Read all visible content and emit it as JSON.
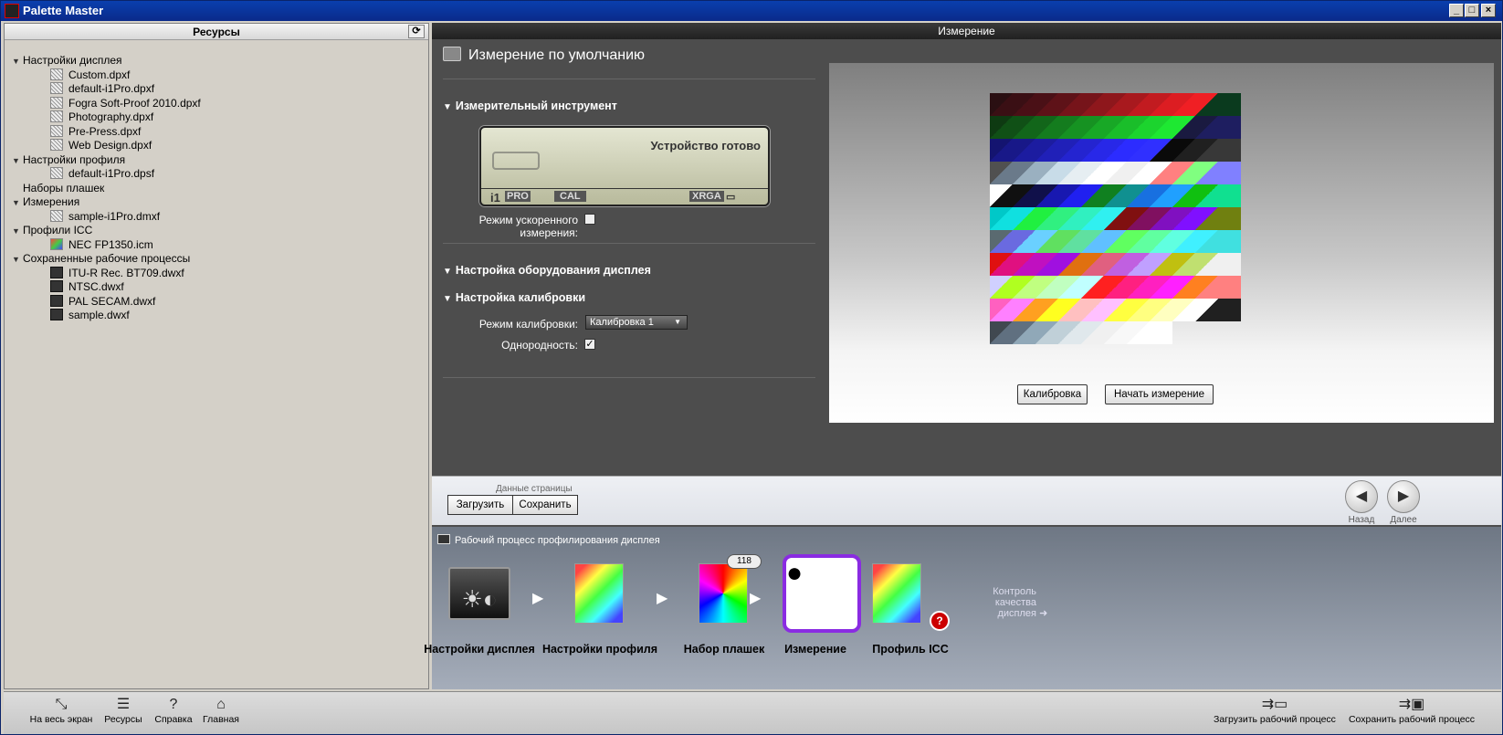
{
  "window": {
    "title": "Palette Master"
  },
  "left_panel": {
    "title": "Ресурсы",
    "tree": [
      {
        "label": "Настройки дисплея",
        "children": [
          "Custom.dpxf",
          "default-i1Pro.dpxf",
          "Fogra Soft-Proof 2010.dpxf",
          "Photography.dpxf",
          "Pre-Press.dpxf",
          "Web Design.dpxf"
        ]
      },
      {
        "label": "Настройки профиля",
        "children": [
          "default-i1Pro.dpsf"
        ]
      },
      {
        "label": "Наборы плашек",
        "children": []
      },
      {
        "label": "Измерения",
        "children": [
          "sample-i1Pro.dmxf"
        ]
      },
      {
        "label": "Профили ICC",
        "children": [
          "NEC FP1350.icm"
        ]
      },
      {
        "label": "Сохраненные рабочие процессы",
        "children": [
          "ITU-R Rec. BT709.dwxf",
          "NTSC.dwxf",
          "PAL SECAM.dwxf",
          "sample.dwxf"
        ]
      }
    ]
  },
  "main": {
    "header": "Измерение",
    "section_title": "Измерение по умолчанию",
    "instrument_group": "Измерительный инструмент",
    "lcd": {
      "status": "Устройство готово",
      "brand": "i1",
      "model": "PRO",
      "cal": "CAL",
      "mode": "XRGA"
    },
    "fast_mode_label": "Режим ускоренного измерения:",
    "fast_mode_checked": false,
    "hardware_group": "Настройка оборудования дисплея",
    "calibration_group": "Настройка калибровки",
    "calibration_mode_label": "Режим калибровки:",
    "calibration_mode_value": "Калибровка 1",
    "uniformity_label": "Однородность:",
    "uniformity_checked": true,
    "preview_buttons": {
      "calibrate": "Калибровка",
      "start": "Начать измерение"
    }
  },
  "page_bar": {
    "caption": "Данные страницы",
    "load": "Загрузить",
    "save": "Сохранить",
    "back": "Назад",
    "next": "Далее"
  },
  "workflow": {
    "title": "Рабочий процесс профилирования дисплея",
    "steps": [
      "Настройки дисплея",
      "Настройки профиля",
      "Набор плашек",
      "Измерение",
      "Профиль ICC"
    ],
    "patch_count": "118",
    "quality_control": "Контроль качества дисплея"
  },
  "bottom_bar": {
    "fullscreen": "На весь экран",
    "resources": "Ресурсы",
    "help": "Справка",
    "home": "Главная",
    "load_workflow": "Загрузить рабочий процесс",
    "save_workflow": "Сохранить рабочий процесс"
  },
  "patches": [
    [
      "#2a0f12",
      "#3a0f14",
      "#4a1016",
      "#5e1218",
      "#76141a",
      "#8e171c",
      "#a8191e",
      "#c21b20",
      "#dc1d22",
      "#f01f24",
      "#0a3a1e"
    ],
    [
      "#0e3a12",
      "#105016",
      "#12661a",
      "#147c1e",
      "#169222",
      "#18a826",
      "#1abe2a",
      "#1cd42e",
      "#1ee832",
      "#1a1a40",
      "#1e1e60"
    ],
    [
      "#141470",
      "#181888",
      "#1c1ca0",
      "#2020b8",
      "#2424d0",
      "#2828e8",
      "#2c2cff",
      "#3030ff",
      "#0a0a0a",
      "#202020",
      "#383838"
    ],
    [
      "#505050",
      "#6a7a8a",
      "#9ab0c0",
      "#c8dce8",
      "#e6eef2",
      "#ffffff",
      "#f0f0f0",
      "#ffffff",
      "#ff8080",
      "#80ff80",
      "#8080ff"
    ],
    [
      "#ffffff",
      "#101010",
      "#10104a",
      "#1818b0",
      "#2020f0",
      "#108020",
      "#109090",
      "#1870e0",
      "#20a0ff",
      "#10c010",
      "#10e090"
    ],
    [
      "#00c8c8",
      "#10e0e0",
      "#20f040",
      "#30f080",
      "#30f0c0",
      "#30f0f0",
      "#801010",
      "#801060",
      "#8010c0",
      "#8010ff",
      "#708010"
    ],
    [
      "#5a6a70",
      "#6a6ae0",
      "#6ad0ff",
      "#60e060",
      "#60e0a0",
      "#60c0ff",
      "#60ff60",
      "#60ffa0",
      "#60ffe0",
      "#40f0ff",
      "#40e0e0"
    ],
    [
      "#e01010",
      "#e01080",
      "#c010c0",
      "#a010e0",
      "#e07010",
      "#e06080",
      "#c060e0",
      "#c0a0ff",
      "#c0c010",
      "#c0e070",
      "#f0f0f0"
    ],
    [
      "#d0d0ff",
      "#b0ff20",
      "#c0ff80",
      "#c0ffc0",
      "#c0ffff",
      "#ff2020",
      "#ff2080",
      "#ff20c0",
      "#ff20ff",
      "#ff8020",
      "#ff8080"
    ],
    [
      "#ff60c0",
      "#ff80ff",
      "#ffa020",
      "#ffff20",
      "#ffc0c0",
      "#ffc0ff",
      "#ffff40",
      "#ffff80",
      "#ffffc0",
      "#ffffff",
      "#202020"
    ],
    [
      "#404850",
      "#607080",
      "#90a8b8",
      "#c0d0d8",
      "#e0e8ec",
      "#f0f0f0",
      "#f8f8f8",
      "#ffffff"
    ]
  ]
}
